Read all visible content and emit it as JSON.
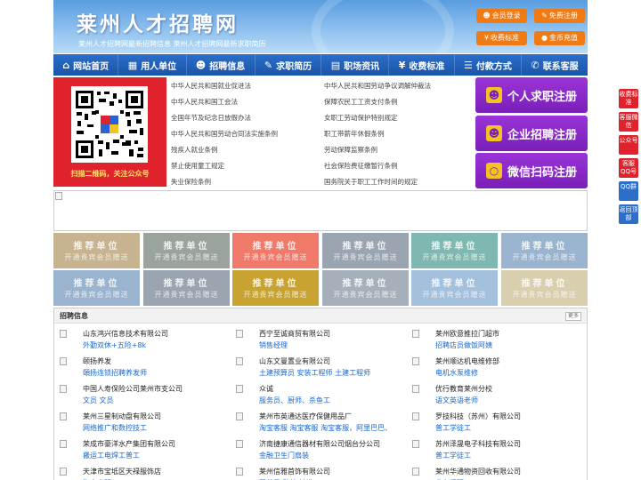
{
  "header": {
    "title": "莱州人才招聘网",
    "subtitle": "莱州人才招聘网最新招聘信息   莱州人才招聘网最新求职简历",
    "buttons": [
      {
        "icon": "user-icon",
        "label": "会员登录"
      },
      {
        "icon": "edit-icon",
        "label": "免费注册"
      },
      {
        "icon": "yen-icon",
        "label": "收费标准"
      },
      {
        "icon": "coin-icon",
        "label": "金币充值"
      }
    ]
  },
  "nav": [
    {
      "icon": "home-icon",
      "label": "网站首页"
    },
    {
      "icon": "building-icon",
      "label": "用人单位"
    },
    {
      "icon": "person-icon",
      "label": "招聘信息"
    },
    {
      "icon": "resume-icon",
      "label": "求职简历"
    },
    {
      "icon": "news-icon",
      "label": "职场资讯"
    },
    {
      "icon": "yen-icon",
      "label": "收费标准"
    },
    {
      "icon": "list-icon",
      "label": "付款方式"
    },
    {
      "icon": "phone-icon",
      "label": "联系客服"
    }
  ],
  "qr": {
    "caption": "扫描二维码，关注公众号",
    "colors": {
      "red": "#e0222c",
      "blue": "#2c5fd0",
      "yellow": "#f5c320"
    }
  },
  "laws": {
    "left": [
      "中华人民共和国就业促进法",
      "中华人民共和国工会法",
      "全国年节及纪念日放假办法",
      "中华人民共和国劳动合同法实施条例",
      "残疾人就业条例",
      "禁止使用童工规定",
      "失业保险条例"
    ],
    "right": [
      "中华人民共和国劳动争议调解仲裁法",
      "保障农民工工资支付条例",
      "女职工劳动保护特别规定",
      "职工带薪年休假条例",
      "劳动保障监察条例",
      "社会保险费征缴暂行条例",
      "国务院关于职工工作时间的规定"
    ]
  },
  "register": [
    {
      "icon": "person-icon",
      "label": "个人求职注册"
    },
    {
      "icon": "person-icon",
      "label": "企业招聘注册"
    },
    {
      "icon": "wechat-icon",
      "label": "微信扫码注册"
    }
  ],
  "promo": {
    "line1": "推荐单位",
    "line2": "开通贵宾会员赠送",
    "colors": [
      "#c7b38f",
      "#9aa49d",
      "#f07a6a",
      "#9aa5b1",
      "#7fb8b0",
      "#9ab3cf",
      "#9ab3cf",
      "#9aa5b1",
      "#c9a331",
      "#a5b0ba",
      "#a3c0dd",
      "#d9cfae"
    ]
  },
  "jobs": {
    "title": "招聘信息",
    "more": "更多",
    "items": [
      {
        "company": "山东鸿兴信息技术有限公司",
        "positions": "外勤双休+五险+8k"
      },
      {
        "company": "西宁至诚商贸有限公司",
        "positions": "销售经理"
      },
      {
        "company": "莱州欧意推拉门超市",
        "positions": "招聘店员做饭阿姨"
      },
      {
        "company": "颐扬养发",
        "positions": "頣扬连锁招聘养发师"
      },
      {
        "company": "山东文曼置业有限公司",
        "positions": "土建预算员 安装工程师 土建工程师"
      },
      {
        "company": "莱州顺达机电维修部",
        "positions": "电机水泵维修"
      },
      {
        "company": "中国人寿保险公司莱州市支公司",
        "positions": "文员 文员"
      },
      {
        "company": "众诚",
        "positions": "服务员、厨师、杀鱼工"
      },
      {
        "company": "优行教育莱州分校",
        "positions": "语文英语老师"
      },
      {
        "company": "莱州三星制动盘有限公司",
        "positions": "网络推广和数控技工"
      },
      {
        "company": "莱州市英通达医疗保健用品厂",
        "positions": "淘宝客服 淘宝客服 淘宝客服，阿里巴巴、"
      },
      {
        "company": "罗技科技（苏州）有限公司",
        "positions": "普工学徒工"
      },
      {
        "company": "荣成市豪洋水产集团有限公司",
        "positions": "搬运工电焊工普工"
      },
      {
        "company": "济南捷康通信器材有限公司烟台分公司",
        "positions": "金融卫生门扇装"
      },
      {
        "company": "苏州泽晟电子科技有限公司",
        "positions": "普工学徒工"
      },
      {
        "company": "天津市宝坻区天禄服饰店",
        "positions": "淘宝客服"
      },
      {
        "company": "莱州信雅首饰有限公司",
        "positions": "跟单员 助统 铸造工"
      },
      {
        "company": "莱州华通物资回收有限公司",
        "positions": "业务经理"
      }
    ]
  },
  "sidebar": [
    {
      "label": "收费标准"
    },
    {
      "label": "客服微信"
    },
    {
      "label": "公众号"
    },
    {
      "label": "客服QQ号"
    },
    {
      "label": "QQ群"
    },
    {
      "label": "返回顶部"
    }
  ]
}
